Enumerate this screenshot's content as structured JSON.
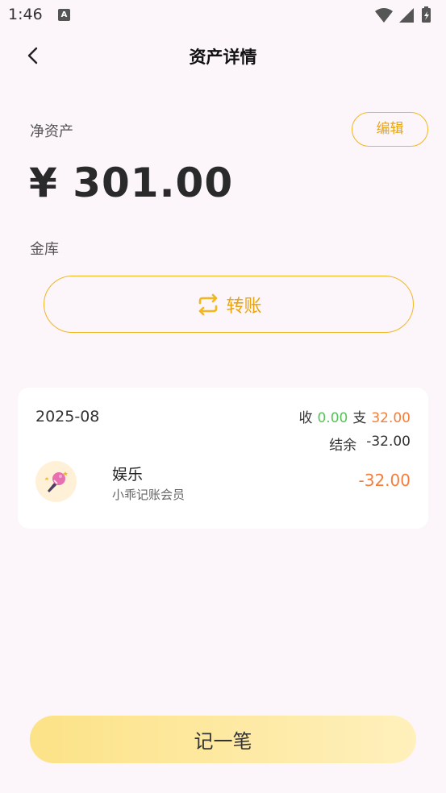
{
  "status_bar": {
    "time": "1:46",
    "a_badge": "A"
  },
  "header": {
    "title": "资产详情"
  },
  "asset": {
    "net_label": "净资产",
    "edit_label": "编辑",
    "net_amount": "¥ 301.00",
    "account_name": "金库",
    "transfer_label": "转账"
  },
  "records": {
    "month": "2025-08",
    "income_label": "收",
    "income_value": "0.00",
    "expense_label": "支",
    "expense_value": "32.00",
    "balance_label": "结余",
    "balance_value": "-32.00",
    "entries": [
      {
        "category": "娱乐",
        "note": "小乖记账会员",
        "amount": "-32.00",
        "icon": "microphone-icon"
      }
    ]
  },
  "bottom": {
    "record_label": "记一笔"
  },
  "colors": {
    "accent": "#F2B71E",
    "income": "#59C25A",
    "expense": "#F47E3C",
    "background": "#FCF5FA"
  }
}
